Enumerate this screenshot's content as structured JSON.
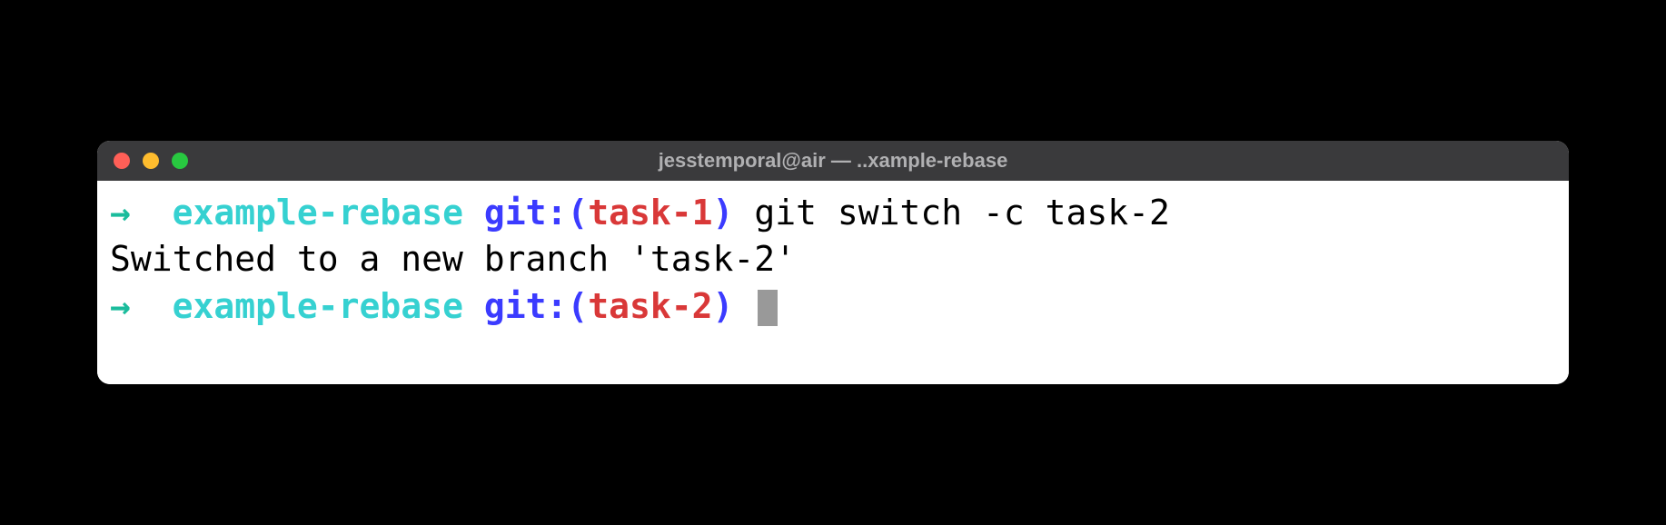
{
  "window": {
    "title": "jesstemporal@air — ..xample-rebase"
  },
  "prompt1": {
    "arrow": "→",
    "dir": "example-rebase",
    "git_prefix": "git:",
    "paren_open": "(",
    "branch": "task-1",
    "paren_close": ")",
    "command": "git switch -c task-2"
  },
  "output1": "Switched to a new branch 'task-2'",
  "prompt2": {
    "arrow": "→",
    "dir": "example-rebase",
    "git_prefix": "git:",
    "paren_open": "(",
    "branch": "task-2",
    "paren_close": ")"
  }
}
